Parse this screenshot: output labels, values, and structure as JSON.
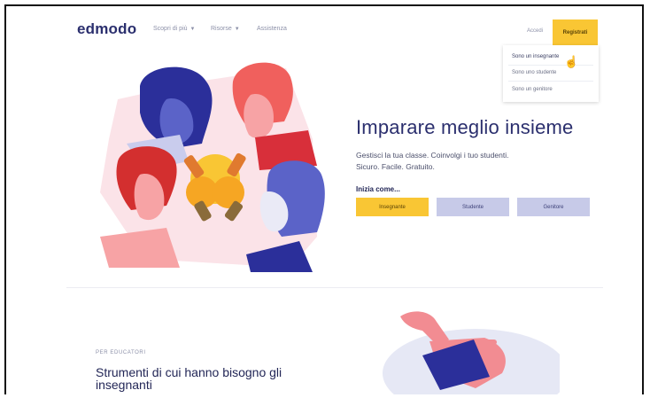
{
  "header": {
    "logo": "edmodo",
    "nav": [
      {
        "label": "Scopri di più",
        "caret": "▼"
      },
      {
        "label": "Risorse",
        "caret": "▼"
      },
      {
        "label": "Assistenza"
      }
    ],
    "login_label": "Accedi",
    "signup_label": "Registrati"
  },
  "dropdown": {
    "items": [
      "Sono un insegnante",
      "Sono uno studente",
      "Sono un genitore"
    ]
  },
  "hero": {
    "title": "Imparare meglio insieme",
    "subtitle_line1": "Gestisci la tua classe. Coinvolgi i tuo studenti.",
    "subtitle_line2": "Sicuro. Facile. Gratuito.",
    "start_label": "Inizia come...",
    "buttons": {
      "teacher": "Insegnante",
      "student": "Studente",
      "parent": "Genitore"
    }
  },
  "section": {
    "eyebrow": "PER EDUCATORI",
    "title": "Strumenti di cui hanno bisogno gli insegnanti"
  },
  "colors": {
    "primary_navy": "#2b2f6e",
    "accent_yellow": "#f9c634",
    "light_lavender": "#c7cae8",
    "coral": "#f0605d",
    "red": "#d32f2f"
  }
}
